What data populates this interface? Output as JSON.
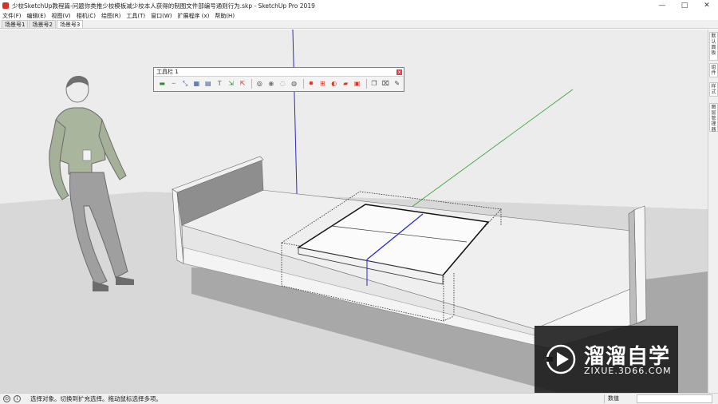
{
  "window": {
    "title": "少校SketchUp教程篇-问题你类推少校模板减少校本人获得的制图文件部编号通则行为.skp - SketchUp Pro 2019",
    "controls": {
      "minimize": "—",
      "maximize": "□",
      "close": "✕"
    }
  },
  "menu": {
    "items": [
      "文件(F)",
      "编辑(E)",
      "视图(V)",
      "相机(C)",
      "绘图(R)",
      "工具(T)",
      "窗口(W)",
      "扩展程序 (x)",
      "帮助(H)"
    ]
  },
  "scenes": {
    "tabs": [
      "场景号1",
      "场景号2",
      "场景号3"
    ],
    "active_index": 2
  },
  "toolbar": {
    "title": "工具栏 1",
    "close_glyph": "x",
    "buttons": [
      {
        "name": "line-style-icon",
        "glyph": "▬",
        "color": "#2e8b2e"
      },
      {
        "name": "dashes-icon",
        "glyph": "┄",
        "color": "#555555"
      },
      {
        "name": "resize-icon",
        "glyph": "⤡",
        "color": "#2a4fa0"
      },
      {
        "name": "grid-icon",
        "glyph": "▦",
        "color": "#2a4fa0"
      },
      {
        "name": "table-icon",
        "glyph": "▤",
        "color": "#2a4fa0"
      },
      {
        "name": "text-icon",
        "glyph": "T",
        "color": "#2e6b8e"
      },
      {
        "name": "dimension-x-icon",
        "glyph": "⇲",
        "color": "#2e8b2e"
      },
      {
        "name": "dimension-y-icon",
        "glyph": "⇱",
        "color": "#cc2a2a"
      },
      {
        "name": "orbit-icon",
        "glyph": "◎",
        "color": "#333333"
      },
      {
        "name": "zoom-icon",
        "glyph": "◉",
        "color": "#777777"
      },
      {
        "name": "zoom-window-icon",
        "glyph": "◌",
        "color": "#777777"
      },
      {
        "name": "camera-icon",
        "glyph": "◍",
        "color": "#555555"
      },
      {
        "name": "sun-icon",
        "glyph": "✸",
        "color": "#dd3322"
      },
      {
        "name": "section-icon",
        "glyph": "⊞",
        "color": "#dd3322"
      },
      {
        "name": "paint-icon",
        "glyph": "◐",
        "color": "#dd3322"
      },
      {
        "name": "folder-red-icon",
        "glyph": "▰",
        "color": "#dd3322"
      },
      {
        "name": "photo-icon",
        "glyph": "▣",
        "color": "#dd3322"
      },
      {
        "name": "copy-icon",
        "glyph": "❐",
        "color": "#444444"
      },
      {
        "name": "open-folder-icon",
        "glyph": "⌧",
        "color": "#444444"
      },
      {
        "name": "measure-tool-icon",
        "glyph": "✎",
        "color": "#444444"
      }
    ]
  },
  "tray": {
    "tabs": [
      "默认面板",
      "组件",
      "样式",
      "图层管理器"
    ]
  },
  "status": {
    "text": "选择对象。切换到扩充选择。拖动鼠标选择多项。",
    "measure_label": "数值",
    "measure_value": ""
  },
  "watermark": {
    "name_cn": "溜溜自学",
    "url": "ZIXUE.3D66.COM"
  },
  "colors": {
    "axis_red": "#cc2a2a",
    "axis_green": "#3aa83a",
    "axis_blue": "#2a2ad0",
    "ground": "#d7d7d7",
    "face_light": "#f2f2f2",
    "face_mid": "#e3e3e3",
    "face_dark": "#8f8f8f",
    "shadow": "#a9a9a9"
  }
}
